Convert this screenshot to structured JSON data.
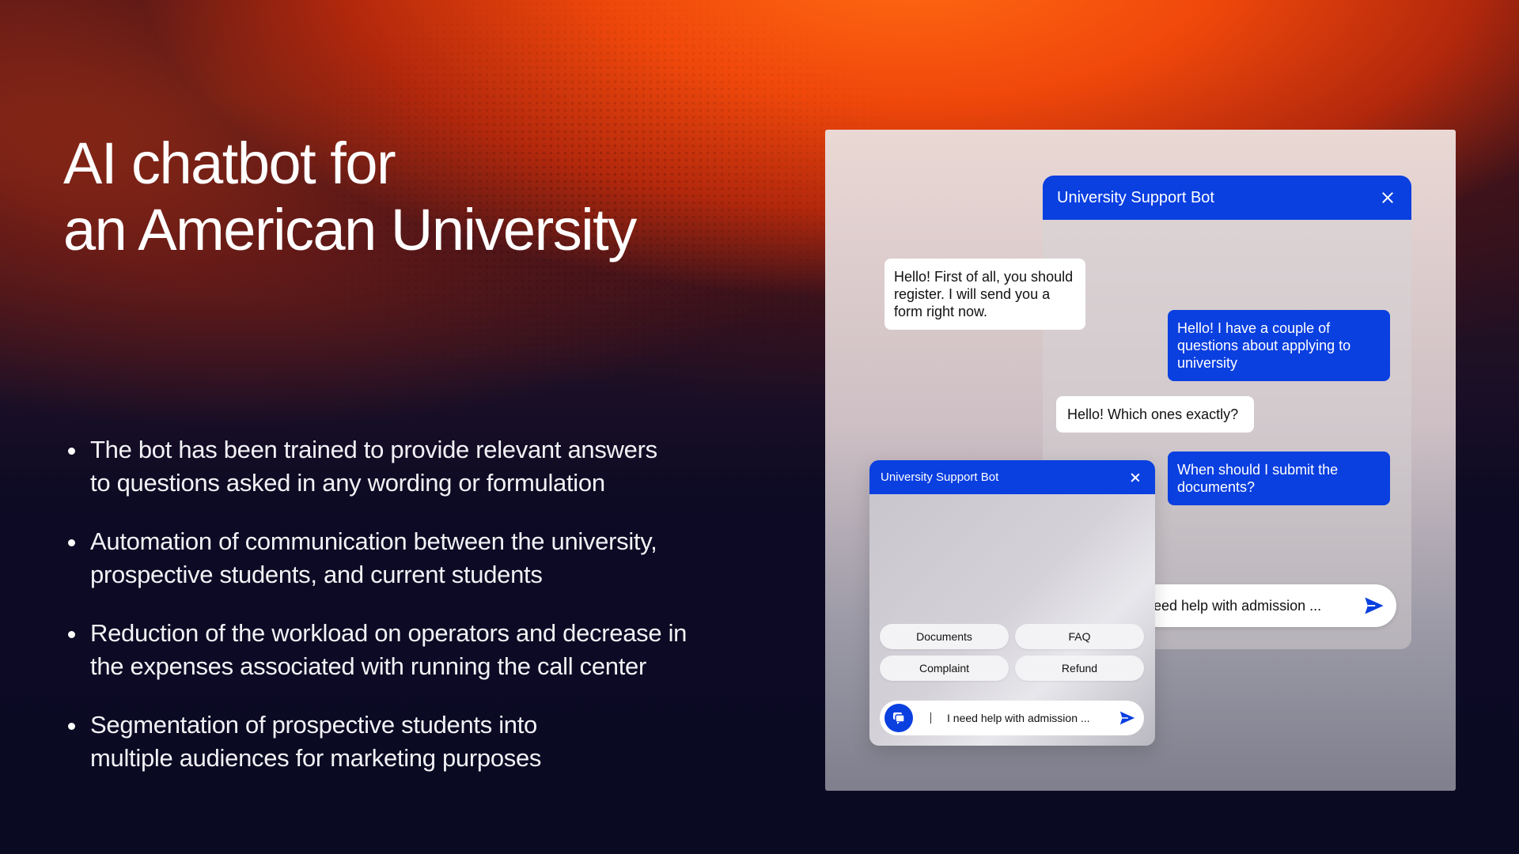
{
  "slide": {
    "title_line1": "AI chatbot for",
    "title_line2": "an American University",
    "bullets": [
      "The bot has been trained to provide relevant answers to questions asked in any wording or formulation",
      "Automation of communication between the university, prospective students, and current students",
      "Reduction of the workload on operators and decrease in the expenses associated with running the call center",
      "Segmentation of prospective students into multiple audiences for marketing purposes"
    ]
  },
  "chat_large": {
    "title": "University Support Bot",
    "messages": [
      {
        "from": "bot",
        "text": "Hello! First of all, you should register. I will send you a form right now."
      },
      {
        "from": "user",
        "text": "Hello! I have a couple of questions about applying to university"
      },
      {
        "from": "bot",
        "text": "Hello! Which ones exactly?"
      },
      {
        "from": "user",
        "text": "When should I submit the documents?"
      }
    ],
    "input_value": "eed help with admission ..."
  },
  "chat_small": {
    "title": "University Support Bot",
    "quick_replies": [
      "Documents",
      "FAQ",
      "Complaint",
      "Refund"
    ],
    "input_value": "I need help with admission ..."
  },
  "colors": {
    "accent": "#0a3fe0",
    "background_dark": "#0c0a24",
    "background_orange": "#f0480b"
  },
  "icons": {
    "close": "close-icon",
    "send": "send-icon",
    "chat": "chat-bubble-icon"
  }
}
